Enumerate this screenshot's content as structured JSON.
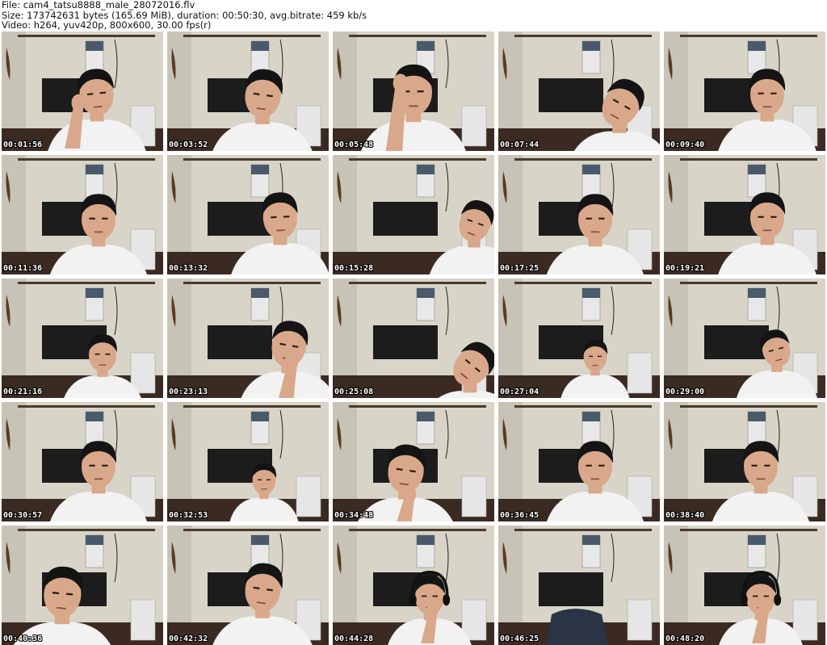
{
  "header": {
    "file_line": "File: cam4_tatsu8888_male_28072016.flv",
    "size_line": "Size: 173742631 bytes (165.69 MiB), duration: 00:50:30, avg.bitrate: 459 kb/s",
    "video_line": "Video: h264, yuv420p, 800x600, 30.00 fps(r)"
  },
  "colors": {
    "wall": "#d8d4c8",
    "wall_shadow": "#bdb8aa",
    "tv": "#1c1c1c",
    "shirt": "#f2f2f2",
    "skin": "#d9a88a",
    "hair": "#141414",
    "floor": "#3a2a22",
    "timestamp_text": "#ffffff"
  },
  "thumbnails": [
    {
      "timestamp": "00:01:56",
      "subject": "person",
      "pose": "hand-on-cheek"
    },
    {
      "timestamp": "00:03:52",
      "subject": "person",
      "pose": "looking-down"
    },
    {
      "timestamp": "00:05:48",
      "subject": "person",
      "pose": "hand-on-forehead"
    },
    {
      "timestamp": "00:07:44",
      "subject": "person",
      "pose": "head-down"
    },
    {
      "timestamp": "00:09:40",
      "subject": "person",
      "pose": "smiling"
    },
    {
      "timestamp": "00:11:36",
      "subject": "person",
      "pose": "neutral"
    },
    {
      "timestamp": "00:13:32",
      "subject": "person",
      "pose": "talking"
    },
    {
      "timestamp": "00:15:28",
      "subject": "person",
      "pose": "leaning-right"
    },
    {
      "timestamp": "00:17:25",
      "subject": "person",
      "pose": "neutral"
    },
    {
      "timestamp": "00:19:21",
      "subject": "person",
      "pose": "smiling"
    },
    {
      "timestamp": "00:21:16",
      "subject": "person",
      "pose": "arms-crossed"
    },
    {
      "timestamp": "00:23:13",
      "subject": "person",
      "pose": "hand-to-mouth"
    },
    {
      "timestamp": "00:25:08",
      "subject": "person",
      "pose": "head-down-right"
    },
    {
      "timestamp": "00:27:04",
      "subject": "person",
      "pose": "seated-far"
    },
    {
      "timestamp": "00:29:00",
      "subject": "person",
      "pose": "tilted-head"
    },
    {
      "timestamp": "00:30:57",
      "subject": "person",
      "pose": "neutral"
    },
    {
      "timestamp": "00:32:53",
      "subject": "person",
      "pose": "seated-far"
    },
    {
      "timestamp": "00:34:48",
      "subject": "person",
      "pose": "hand-on-chin"
    },
    {
      "timestamp": "00:36:45",
      "subject": "person",
      "pose": "neutral"
    },
    {
      "timestamp": "00:38:40",
      "subject": "person",
      "pose": "neutral"
    },
    {
      "timestamp": "00:40:36",
      "subject": "person",
      "pose": "close-up"
    },
    {
      "timestamp": "00:42:32",
      "subject": "person",
      "pose": "looking-down"
    },
    {
      "timestamp": "00:44:28",
      "subject": "person",
      "pose": "headphones"
    },
    {
      "timestamp": "00:46:25",
      "subject": "empty-room",
      "pose": "none"
    },
    {
      "timestamp": "00:48:20",
      "subject": "person",
      "pose": "headphones"
    }
  ]
}
